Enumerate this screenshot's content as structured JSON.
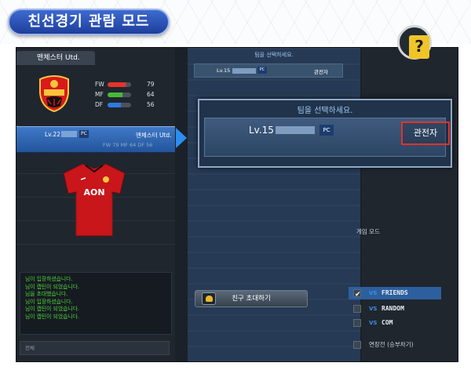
{
  "header": {
    "title": "친선경기 관람 모드"
  },
  "left_panel": {
    "team_tab": "맨체스터 Utd.",
    "stats": [
      {
        "label": "FW",
        "value": "79",
        "fill": 0.79,
        "color": "#e3352a"
      },
      {
        "label": "MF",
        "value": "64",
        "fill": 0.64,
        "color": "#48b83a"
      },
      {
        "label": "DF",
        "value": "56",
        "fill": 0.56,
        "color": "#2f7ae0"
      }
    ],
    "player_card": {
      "level": "Lv.22",
      "badge": "PC",
      "team": "맨체스터 Utd.",
      "stats_line": "FW 79  MF 64  DF 56"
    },
    "chat_lines": [
      "님이 입장하셨습니다.",
      "님이 캡틴이 되었습니다.",
      "님을 초대했습니다.",
      "님이 입장하셨습니다.",
      "님이 캡틴이 되었습니다.",
      "님이 캡틴이 되었습니다."
    ],
    "chat_input_placeholder": "전체"
  },
  "middle": {
    "title": "팀을 선택하세요.",
    "slot": {
      "level": "Lv.15",
      "badge": "PC",
      "spectator": "관전자"
    },
    "invite_button": "친구 초대하기"
  },
  "zoom_popup": {
    "title": "팀을 선택하세요.",
    "level": "Lv.15",
    "badge": "PC",
    "spectator": "관전자"
  },
  "right_panel": {
    "help_symbol": "?",
    "mode_title": "게임 모드",
    "modes": [
      {
        "vs": "VS",
        "label": "FRIENDS",
        "selected": true
      },
      {
        "vs": "VS",
        "label": "RANDOM",
        "selected": false
      },
      {
        "vs": "VS",
        "label": "COM",
        "selected": false
      }
    ],
    "overtime": "연장전 (승부차기)"
  },
  "icons": {
    "crest": "manchester-united-crest-icon",
    "jersey": "red-jersey-icon",
    "help": "question-mark-icon",
    "arrow": "arrow-right-icon",
    "invite": "invite-friends-icon"
  }
}
